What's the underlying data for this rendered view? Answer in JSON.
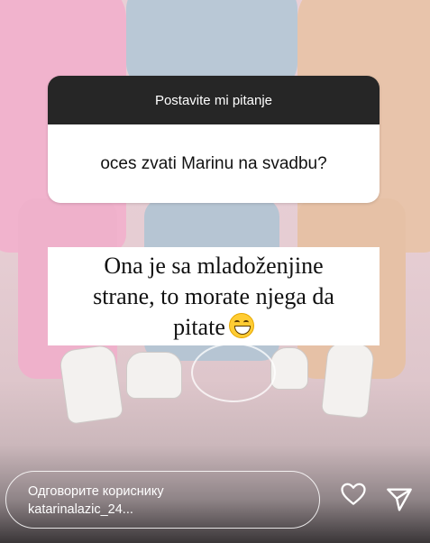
{
  "question_box": {
    "header": "Postavite mi pitanje",
    "question": "oces zvati Marinu na svadbu?"
  },
  "answer": {
    "line1": "Ona je sa mladoženjine",
    "line2": "strane, to morate njega da",
    "line3": "pitate",
    "emoji": "grinning-face-emoji"
  },
  "reply_bar": {
    "line1": "Одговорите кориснику",
    "line2": "katarinalazic_24..."
  },
  "icons": [
    "heart-icon",
    "send-icon"
  ],
  "colors": {
    "header_bg": "#262626",
    "card_bg": "#ffffff",
    "text_light": "#ffffff"
  }
}
